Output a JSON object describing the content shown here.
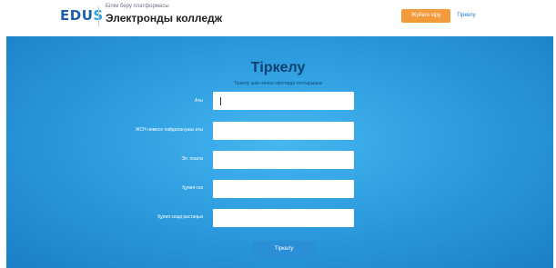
{
  "header": {
    "logo_main": "EDU",
    "logo_accent": "S",
    "brand_subtitle": "Білім беру платформасы",
    "brand_title": "Электронды колледж",
    "login_label": "Жүйеге кіру",
    "register_label": "Тіркелу"
  },
  "form": {
    "title": "Тіркелу",
    "subtitle": "Тіркелу үшін келесі өрістерді толтырыңыз",
    "fields": [
      {
        "label": "Аты",
        "value": ""
      },
      {
        "label": "ЖСН немесе пайдаланушы аты",
        "value": ""
      },
      {
        "label": "Эл. пошта",
        "value": ""
      },
      {
        "label": "Құпия сөз",
        "value": ""
      },
      {
        "label": "Құпия сөзді растаңыз",
        "value": ""
      }
    ],
    "submit_label": "Тіркелу"
  },
  "colors": {
    "accent_orange": "#f39b3a",
    "brand_blue": "#1f5fa8",
    "hero_blue": "#2e9ddf"
  }
}
